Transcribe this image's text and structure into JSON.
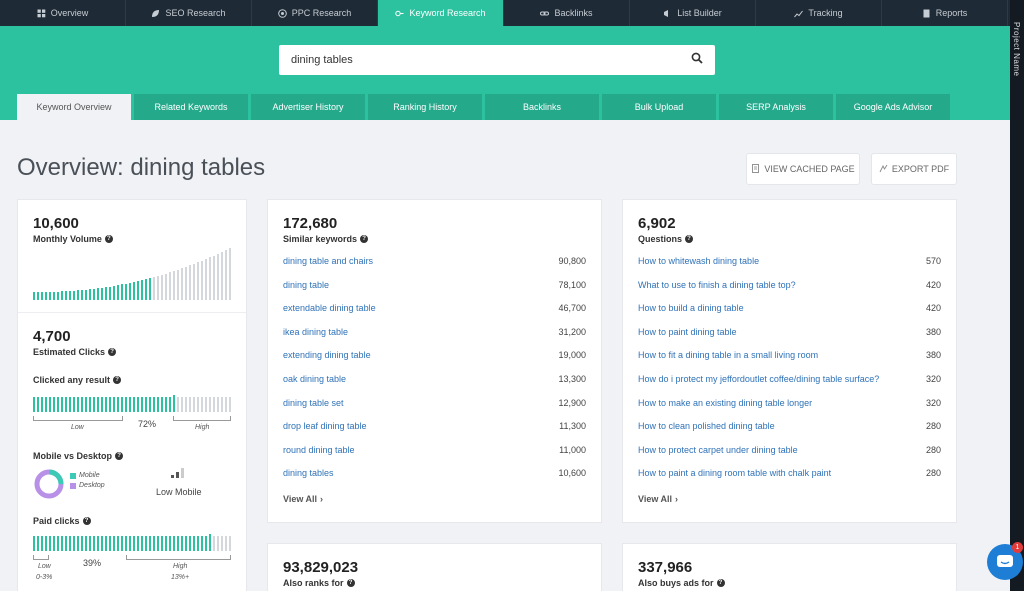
{
  "topnav": [
    {
      "label": "Overview",
      "icon": "grid-icon",
      "active": false
    },
    {
      "label": "SEO Research",
      "icon": "leaf-icon",
      "active": false
    },
    {
      "label": "PPC Research",
      "icon": "target-icon",
      "active": false
    },
    {
      "label": "Keyword Research",
      "icon": "key-icon",
      "active": true
    },
    {
      "label": "Backlinks",
      "icon": "link-icon",
      "active": false
    },
    {
      "label": "List Builder",
      "icon": "megaphone-icon",
      "active": false
    },
    {
      "label": "Tracking",
      "icon": "chart-line-icon",
      "active": false
    },
    {
      "label": "Reports",
      "icon": "document-icon",
      "active": false
    }
  ],
  "side_strip_text": "Project Name",
  "search": {
    "value": "dining tables",
    "icon": "search-icon"
  },
  "subtabs": [
    {
      "label": "Keyword Overview",
      "active": true
    },
    {
      "label": "Related Keywords",
      "active": false
    },
    {
      "label": "Advertiser History",
      "active": false
    },
    {
      "label": "Ranking History",
      "active": false
    },
    {
      "label": "Backlinks",
      "active": false
    },
    {
      "label": "Bulk Upload",
      "active": false
    },
    {
      "label": "SERP Analysis",
      "active": false
    },
    {
      "label": "Google Ads Advisor",
      "active": false
    }
  ],
  "page_title": "Overview: dining tables",
  "buttons": {
    "cached": "VIEW CACHED PAGE",
    "export": "EXPORT PDF"
  },
  "volume": {
    "value": "10,600",
    "label": "Monthly Volume",
    "trend_fraction": 0.6
  },
  "clicks": {
    "value": "4,700",
    "label": "Estimated Clicks"
  },
  "clicked_any": {
    "label": "Clicked any result",
    "percent": "72%",
    "fill": 0.72,
    "low": "Low",
    "high": "High"
  },
  "mobile_desktop": {
    "label": "Mobile vs Desktop",
    "mobile": "Mobile",
    "desktop": "Desktop",
    "result": "Low Mobile",
    "mobile_color": "#3cc9b5",
    "desktop_color": "#b890e8",
    "mobile_fraction": 0.25
  },
  "paid_clicks": {
    "label": "Paid clicks",
    "percent": "39%",
    "fill": 0.9,
    "low": "Low",
    "low_range": "0-3%",
    "high": "High",
    "high_range": "13%+"
  },
  "similar": {
    "value": "172,680",
    "label": "Similar keywords",
    "items": [
      {
        "k": "dining table and chairs",
        "v": "90,800"
      },
      {
        "k": "dining table",
        "v": "78,100"
      },
      {
        "k": "extendable dining table",
        "v": "46,700"
      },
      {
        "k": "ikea dining table",
        "v": "31,200"
      },
      {
        "k": "extending dining table",
        "v": "19,000"
      },
      {
        "k": "oak dining table",
        "v": "13,300"
      },
      {
        "k": "dining table set",
        "v": "12,900"
      },
      {
        "k": "drop leaf dining table",
        "v": "11,300"
      },
      {
        "k": "round dining table",
        "v": "11,000"
      },
      {
        "k": "dining tables",
        "v": "10,600"
      }
    ],
    "view_all": "View All"
  },
  "questions": {
    "value": "6,902",
    "label": "Questions",
    "items": [
      {
        "k": "How to whitewash dining table",
        "v": "570"
      },
      {
        "k": "What to use to finish a dining table top?",
        "v": "420"
      },
      {
        "k": "How to build a dining table",
        "v": "420"
      },
      {
        "k": "How to paint dining table",
        "v": "380"
      },
      {
        "k": "How to fit a dining table in a small living room",
        "v": "380"
      },
      {
        "k": "How do i protect my jeffordoutlet coffee/dining table surface?",
        "v": "320"
      },
      {
        "k": "How to make an existing dining table longer",
        "v": "320"
      },
      {
        "k": "How to clean polished dining table",
        "v": "280"
      },
      {
        "k": "How to protect carpet under dining table",
        "v": "280"
      },
      {
        "k": "How to paint a dining room table with chalk paint",
        "v": "280"
      }
    ],
    "view_all": "View All"
  },
  "also_ranks": {
    "value": "93,829,023",
    "label": "Also ranks for"
  },
  "also_buys": {
    "value": "337,966",
    "label": "Also buys ads for"
  },
  "chat": {
    "icon": "chat-icon",
    "badge": "1"
  },
  "colors": {
    "teal": "#2cc29f",
    "nav": "#1e2a36",
    "link": "#2f72b8"
  }
}
